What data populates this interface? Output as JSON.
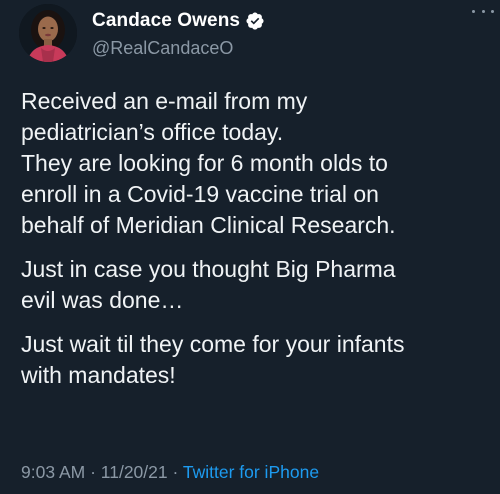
{
  "author": {
    "display_name": "Candace Owens",
    "handle": "@RealCandaceO",
    "verified": true
  },
  "icons": {
    "verified": "verified-badge-icon",
    "more": "more-options-icon",
    "avatar": "profile-photo"
  },
  "tweet": {
    "paragraphs": [
      [
        "Received an e-mail from my",
        "pediatrician’s office today.",
        "They are looking for 6 month olds to",
        "enroll in a Covid-19 vaccine trial on",
        "behalf of Meridian Clinical Research."
      ],
      [
        "Just in case you thought Big Pharma",
        "evil was done…"
      ],
      [
        "Just wait til they come for your infants",
        "with mandates!"
      ]
    ]
  },
  "meta": {
    "time": "9:03 AM",
    "separator": "·",
    "date": "11/20/21",
    "source": "Twitter for iPhone"
  },
  "colors": {
    "background": "#16202b",
    "text": "#f0f3f5",
    "secondary": "#8b98a5",
    "link": "#1d9bf0"
  }
}
